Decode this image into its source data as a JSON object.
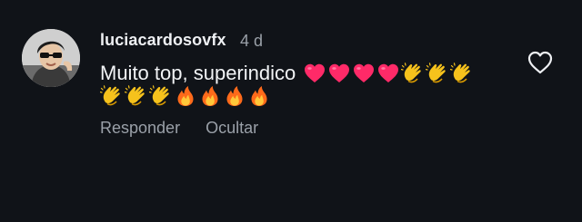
{
  "comment": {
    "username": "luciacardosovfx",
    "timestamp": "4 d",
    "text": "Muito top, superindico",
    "emojis_line1": [
      "heart",
      "heart",
      "heart",
      "heart",
      "clap",
      "clap",
      "clap"
    ],
    "emojis_line2": [
      "clap",
      "clap",
      "clap",
      "fire",
      "fire",
      "fire",
      "fire"
    ],
    "actions": {
      "reply_label": "Responder",
      "hide_label": "Ocultar"
    }
  },
  "colors": {
    "background": "#101318",
    "text": "#f2f4f6",
    "muted": "#9aa0a8",
    "heart_emoji": "#ff2a68",
    "clap_emoji": "#f6c21c",
    "fire_emoji": "#ff6a1a"
  },
  "icons": {
    "like": "heart-outline-icon"
  }
}
